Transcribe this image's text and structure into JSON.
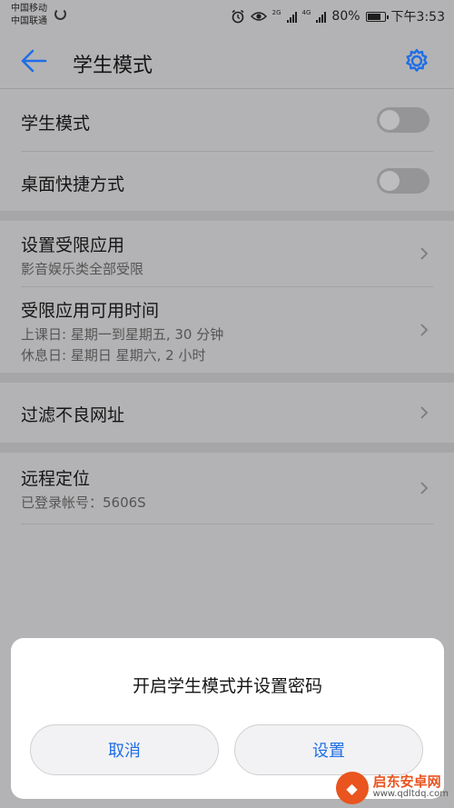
{
  "status_bar": {
    "carrier1": "中国移动",
    "carrier2": "中国联通",
    "net1": "2G",
    "net2": "4G",
    "battery_percent": "80%",
    "battery_level": 0.8,
    "time": "下午3:53"
  },
  "appbar": {
    "title": "学生模式",
    "back_icon": "arrow-left-icon",
    "settings_icon": "gear-icon",
    "accent_color": "#1f6ee6"
  },
  "settings": {
    "student_mode": {
      "label": "学生模式",
      "enabled": false
    },
    "desktop_shortcut": {
      "label": "桌面快捷方式",
      "enabled": false
    },
    "restricted_apps": {
      "label": "设置受限应用",
      "sub": "影音娱乐类全部受限"
    },
    "usage_time": {
      "label": "受限应用可用时间",
      "sub1": "上课日: 星期一到星期五, 30 分钟",
      "sub2": "休息日: 星期日 星期六, 2 小时"
    },
    "url_filter": {
      "label": "过滤不良网址"
    },
    "remote_location": {
      "label": "远程定位",
      "sub": "已登录帐号：5606S"
    }
  },
  "dialog": {
    "message": "开启学生模式并设置密码",
    "cancel_label": "取消",
    "confirm_label": "设置"
  },
  "watermark": {
    "name": "启东安卓网",
    "url": "www.qdltdq.com"
  }
}
